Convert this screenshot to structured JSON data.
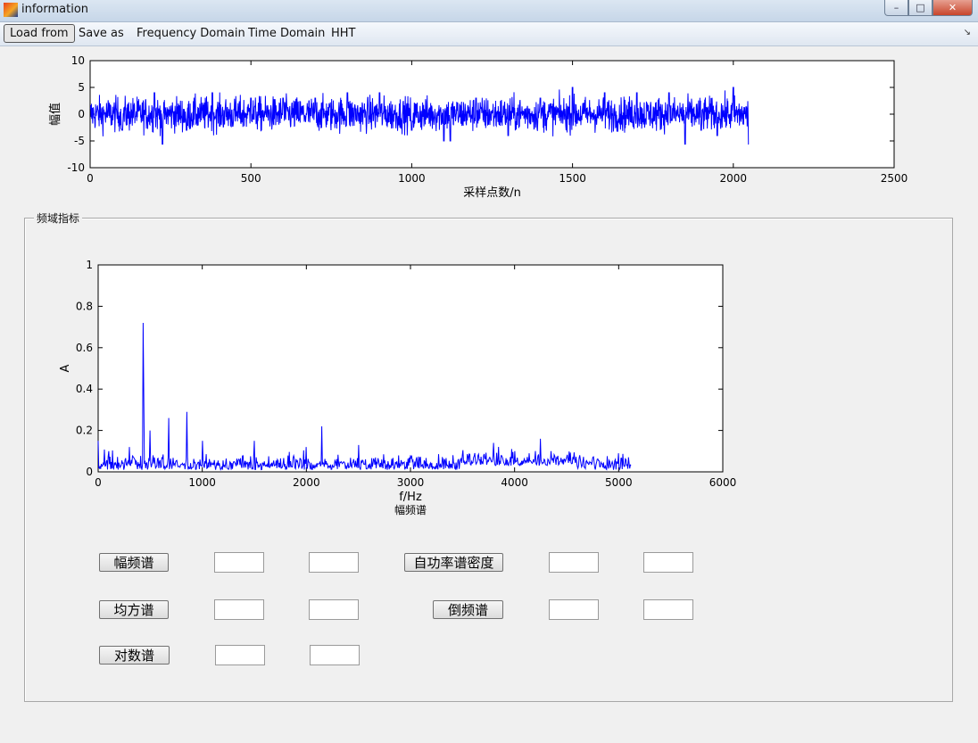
{
  "window": {
    "title": "information",
    "buttons": {
      "minimize": "–",
      "maximize": "□",
      "close": "✕"
    }
  },
  "toolbar": {
    "items": [
      "Load from",
      "Save as",
      "Frequency Domain",
      "Time Domain",
      "HHT"
    ],
    "overflow": "↘"
  },
  "panel": {
    "title": "频域指标"
  },
  "buttons": {
    "amplitude_spectrum": "幅频谱",
    "psd": "自功率谱密度",
    "mean_square_spectrum": "均方谱",
    "cepstrum": "倒频谱",
    "log_spectrum": "对数谱"
  },
  "fields": {
    "amp_1": "",
    "amp_2": "",
    "psd_1": "",
    "psd_2": "",
    "ms_1": "",
    "ms_2": "",
    "cep_1": "",
    "cep_2": "",
    "log_1": "",
    "log_2": ""
  },
  "colors": {
    "series": "#0000ff"
  },
  "chart_data": [
    {
      "type": "line",
      "xlabel": "采样点数/n",
      "ylabel": "幅值",
      "xlim": [
        0,
        2500
      ],
      "ylim": [
        -10,
        10
      ],
      "xticks": [
        "0",
        "500",
        "1000",
        "1500",
        "2000",
        "2500"
      ],
      "yticks": [
        "10",
        "5",
        "0",
        "-5",
        "-10"
      ],
      "series": [
        {
          "x": [
            0,
            100,
            200,
            225,
            300,
            380,
            500,
            600,
            700,
            800,
            900,
            1000,
            1100,
            1120,
            1200,
            1300,
            1400,
            1500,
            1600,
            1700,
            1800,
            1850,
            1900,
            1950,
            2000,
            2048
          ],
          "values": [
            1,
            3,
            4,
            6,
            -3,
            -4,
            3,
            -3,
            3,
            -4,
            4,
            3,
            -5,
            5,
            3,
            4,
            3,
            -5,
            4,
            -4,
            4,
            6,
            -3,
            4,
            5,
            6
          ]
        }
      ]
    },
    {
      "type": "line",
      "xlabel": "f/Hz",
      "ylabel": "A",
      "title": "幅频谱",
      "xlim": [
        0,
        6000
      ],
      "ylim": [
        0,
        1
      ],
      "xticks": [
        "0",
        "1000",
        "2000",
        "3000",
        "4000",
        "5000",
        "6000"
      ],
      "yticks": [
        "1",
        "0.8",
        "0.6",
        "0.4",
        "0.2",
        "0"
      ],
      "series": [
        {
          "x": [
            0,
            100,
            300,
            430,
            440,
            500,
            680,
            850,
            1000,
            1500,
            2000,
            2150,
            2500,
            3000,
            3500,
            3800,
            4000,
            4250,
            4500,
            5000,
            5120
          ],
          "values": [
            0.15,
            0.1,
            0.12,
            0.72,
            0.38,
            0.2,
            0.26,
            0.29,
            0.15,
            0.15,
            0.12,
            0.22,
            0.13,
            0.08,
            0.08,
            0.14,
            0.1,
            0.16,
            0.07,
            0.09,
            0.03
          ]
        }
      ]
    }
  ]
}
